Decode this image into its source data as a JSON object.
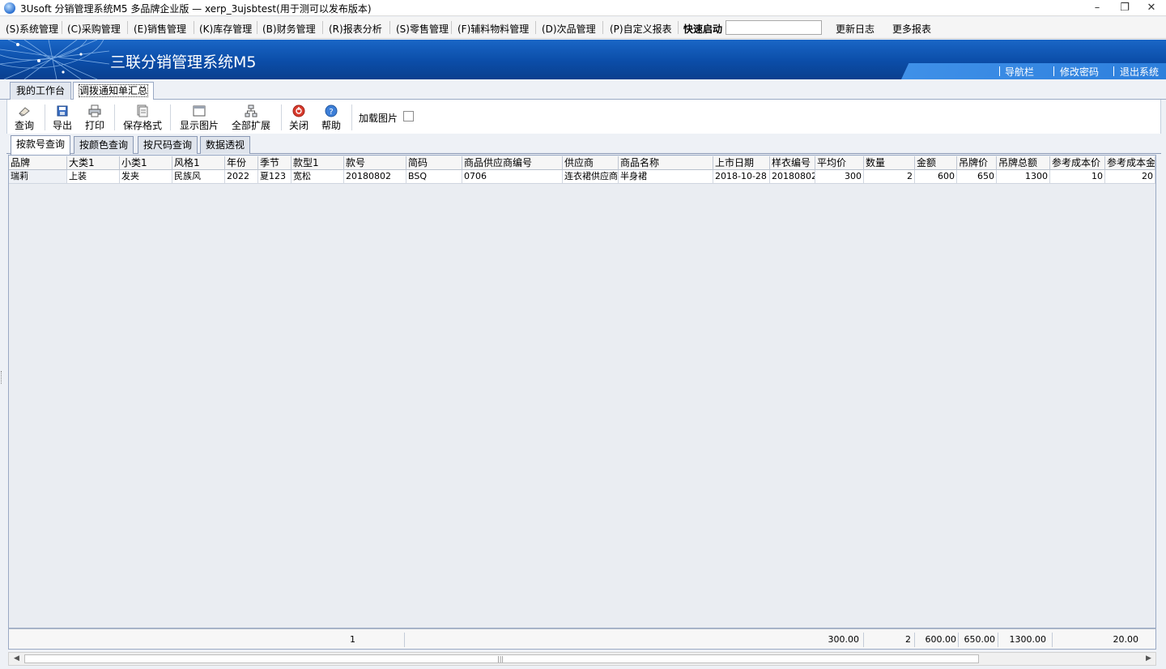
{
  "window": {
    "title": "3Usoft 分销管理系统M5 多品牌企业版 — xerp_3ujsbtest(用于测可以发布版本)"
  },
  "menu": {
    "items": [
      {
        "label": "(S)系统管理"
      },
      {
        "label": "(C)采购管理"
      },
      {
        "label": "(E)销售管理"
      },
      {
        "label": "(K)库存管理"
      },
      {
        "label": "(B)财务管理"
      },
      {
        "label": "(R)报表分析"
      },
      {
        "label": "(S)零售管理"
      },
      {
        "label": "(F)辅料物料管理"
      },
      {
        "label": "(D)次品管理"
      },
      {
        "label": "(P)自定义报表"
      }
    ],
    "quick_launch_label": "快速启动",
    "quick_launch_value": "",
    "extra": [
      {
        "label": "更新日志"
      },
      {
        "label": "更多报表"
      }
    ]
  },
  "banner": {
    "title": "三联分销管理系统M5",
    "links": [
      {
        "label": "导航栏"
      },
      {
        "label": "修改密码"
      },
      {
        "label": "退出系统"
      }
    ]
  },
  "doc_tabs": [
    {
      "label": "我的工作台"
    },
    {
      "label": "调拨通知单汇总"
    }
  ],
  "toolbar": {
    "buttons": [
      {
        "label": "查询",
        "icon": "eraser-icon"
      },
      {
        "label": "导出",
        "icon": "save-disk-icon"
      },
      {
        "label": "打印",
        "icon": "printer-icon"
      },
      {
        "label": "保存格式",
        "icon": "layout-icon"
      },
      {
        "label": "显示图片",
        "icon": "window-icon"
      },
      {
        "label": "全部扩展",
        "icon": "tree-icon"
      },
      {
        "label": "关闭",
        "icon": "close-circle-icon"
      },
      {
        "label": "帮助",
        "icon": "help-icon"
      }
    ],
    "load_images_label": "加载图片",
    "load_images_checked": false
  },
  "inner_tabs": [
    {
      "label": "按款号查询"
    },
    {
      "label": "按颜色查询"
    },
    {
      "label": "按尺码查询"
    },
    {
      "label": "数据透视"
    }
  ],
  "grid": {
    "columns": [
      "品牌",
      "大类1",
      "小类1",
      "风格1",
      "年份",
      "季节",
      "款型1",
      "款号",
      "简码",
      "商品供应商编号",
      "供应商",
      "商品名称",
      "上市日期",
      "样衣编号",
      "平均价",
      "数量",
      "金额",
      "吊牌价",
      "吊牌总额",
      "参考成本价",
      "参考成本金"
    ],
    "rows": [
      [
        "瑞莉",
        "上装",
        "发夹",
        "民族风",
        "2022",
        "夏123",
        "宽松",
        "20180802",
        "BSQ",
        "0706",
        "连衣裙供应商",
        "半身裙",
        "2018-10-28",
        "20180802",
        "300",
        "2",
        "600",
        "650",
        "1300",
        "10",
        "20"
      ]
    ]
  },
  "summary": {
    "count": "1",
    "avg_price": "300.00",
    "qty": "2",
    "amount": "600.00",
    "tag_price": "650.00",
    "tag_total": "1300.00",
    "cost_total": "20.00"
  }
}
